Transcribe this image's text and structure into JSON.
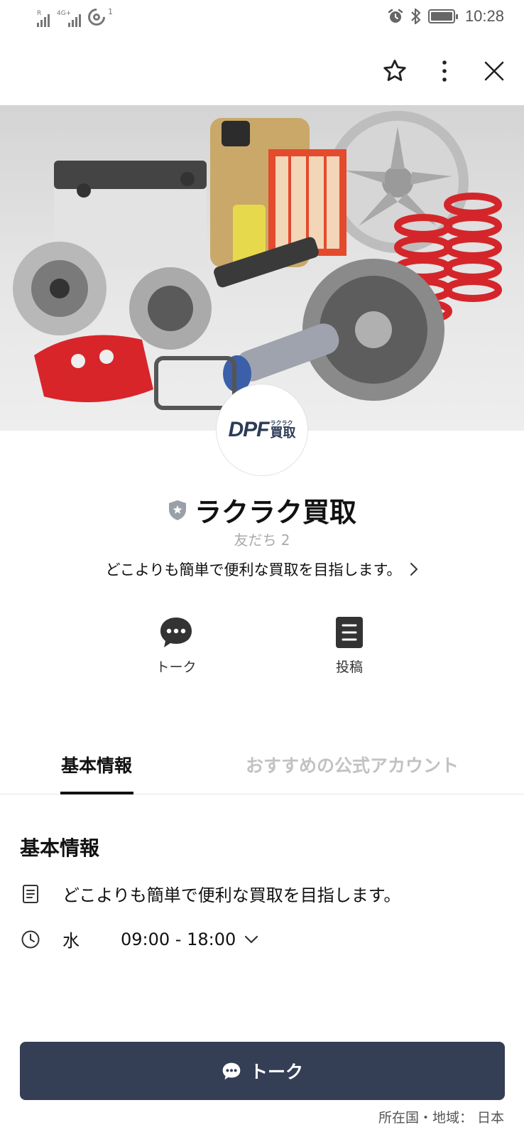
{
  "status_bar": {
    "signal1_label": "R",
    "signal2_label": "4G+",
    "hotspot_sup": "1",
    "time": "10:28"
  },
  "header": {
    "icons": [
      "star-icon",
      "more-vertical-icon",
      "close-icon"
    ]
  },
  "cover": {
    "icon": "auto-parts-photo"
  },
  "profile": {
    "logo_main": "DPF",
    "logo_kana": "ラクラク",
    "logo_kanji": "買取",
    "name": "ラクラク買取",
    "friends": "友だち 2",
    "description": "どこよりも簡単で便利な買取を目指します。"
  },
  "actions": [
    {
      "label": "トーク",
      "icon": "chat-bubble-icon"
    },
    {
      "label": "投稿",
      "icon": "post-icon"
    }
  ],
  "tabs": [
    {
      "label": "基本情報",
      "active": true
    },
    {
      "label": "おすすめの公式アカウント",
      "active": false
    }
  ],
  "basic_info": {
    "title": "基本情報",
    "description": "どこよりも簡単で便利な買取を目指します。",
    "hours_day": "水",
    "hours_time": "09:00 - 18:00"
  },
  "cta": {
    "label": "トーク",
    "color": "#343f56"
  },
  "footer": "所在国・地域： 日本"
}
